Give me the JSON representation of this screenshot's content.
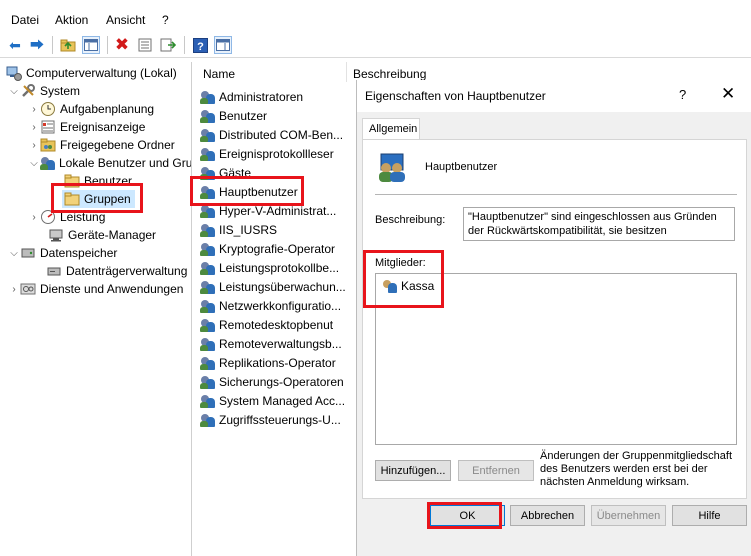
{
  "window_title": "Computerverwaltung",
  "menu": [
    "Datei",
    "Aktion",
    "Ansicht",
    "?"
  ],
  "toolbar_icons": [
    "back-arrow-icon",
    "forward-arrow-icon",
    "up-folder-icon",
    "show-tree-icon",
    "delete-icon",
    "properties-icon",
    "export-icon",
    "help-icon",
    "console-icon"
  ],
  "tree": {
    "root": "Computerverwaltung (Lokal)",
    "system": "System",
    "aufgabenplanung": "Aufgabenplanung",
    "ereignisanzeige": "Ereignisanzeige",
    "freigegebene": "Freigegebene Ordner",
    "lokale": "Lokale Benutzer und Gruppen",
    "benutzer": "Benutzer",
    "gruppen": "Gruppen",
    "leistung": "Leistung",
    "geraete": "Geräte-Manager",
    "datenspeicher": "Datenspeicher",
    "datentraeger": "Datenträgerverwaltung",
    "dienste": "Dienste und Anwendungen"
  },
  "list": {
    "col_name": "Name",
    "col_desc": "Beschreibung",
    "items": [
      "Administratoren",
      "Benutzer",
      "Distributed COM-Ben...",
      "Ereignisprotokollleser",
      "Gäste",
      "Hauptbenutzer",
      "Hyper-V-Administrat...",
      "IIS_IUSRS",
      "Kryptografie-Operator",
      "Leistungsprotokollbe...",
      "Leistungsüberwachun...",
      "Netzwerkkonfiguratio...",
      "Remotedesktopbenut",
      "Remoteverwaltungsb...",
      "Replikations-Operator",
      "Sicherungs-Operatoren",
      "System Managed Acc...",
      "Zugriffssteuerungs-U..."
    ]
  },
  "dialog": {
    "title": "Eigenschaften von Hauptbenutzer",
    "help": "?",
    "close": "✕",
    "tab": "Allgemein",
    "group_name": "Hauptbenutzer",
    "desc_label": "Beschreibung:",
    "desc_value": "\"Hauptbenutzer\" sind eingeschlossen aus Gründen der Rückwärtskompatibilität, sie besitzen eingeschränkte",
    "members_label": "Mitglieder:",
    "members": [
      "Kassa"
    ],
    "add_button": "Hinzufügen...",
    "remove_button": "Entfernen",
    "note": "Änderungen der Gruppenmitgliedschaft des Benutzers werden erst bei der nächsten Anmeldung wirksam.",
    "ok": "OK",
    "cancel": "Abbrechen",
    "apply": "Übernehmen",
    "help_button": "Hilfe"
  },
  "colors": {
    "highlight": "#e8141b",
    "selection": "#cce8ff",
    "dialog_bg": "#f0f0f0"
  }
}
